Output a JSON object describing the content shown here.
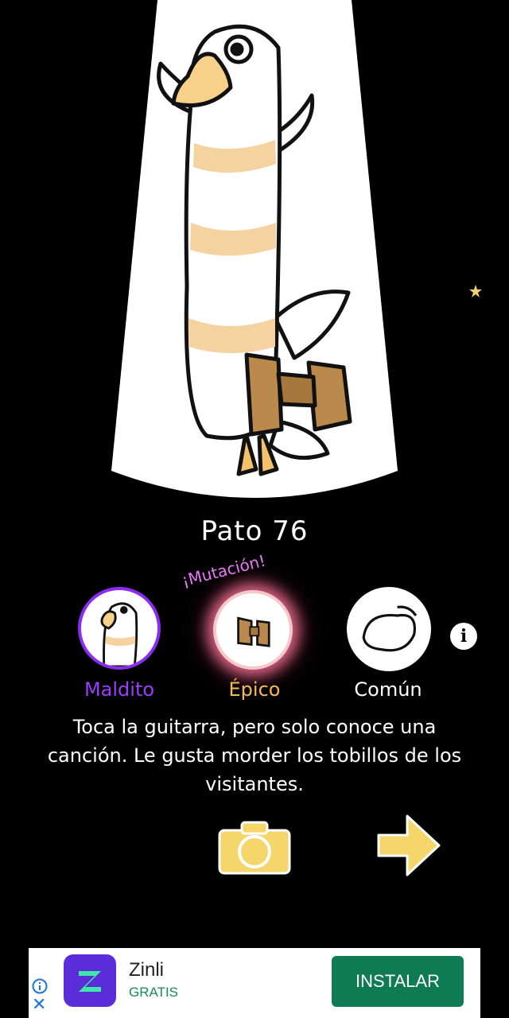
{
  "duck": {
    "name": "Pato 76",
    "mutation_label": "¡Mutación!",
    "traits": [
      {
        "rarity": "Maldito",
        "color": "#9b3cff"
      },
      {
        "rarity": "Épico",
        "color": "#f6b95a"
      },
      {
        "rarity": "Común",
        "color": "#ffffff"
      }
    ],
    "description": "Toca la guitarra, pero solo conoce una canción. Le gusta morder los tobillos de los visitantes."
  },
  "icons": {
    "info": "info-icon",
    "camera": "camera-icon",
    "next": "arrow-right-icon",
    "star": "star-icon"
  },
  "info_glyph": "i",
  "ad": {
    "app_name": "Zinli",
    "app_subtitle": "GRATIS",
    "install_label": "INSTALAR",
    "close_glyph": "✕",
    "colors": {
      "install_bg": "#0f7b52",
      "app_icon_bg": "#5b2dd9"
    }
  },
  "colors": {
    "background": "#000000",
    "button_yellow": "#f5d66b"
  }
}
